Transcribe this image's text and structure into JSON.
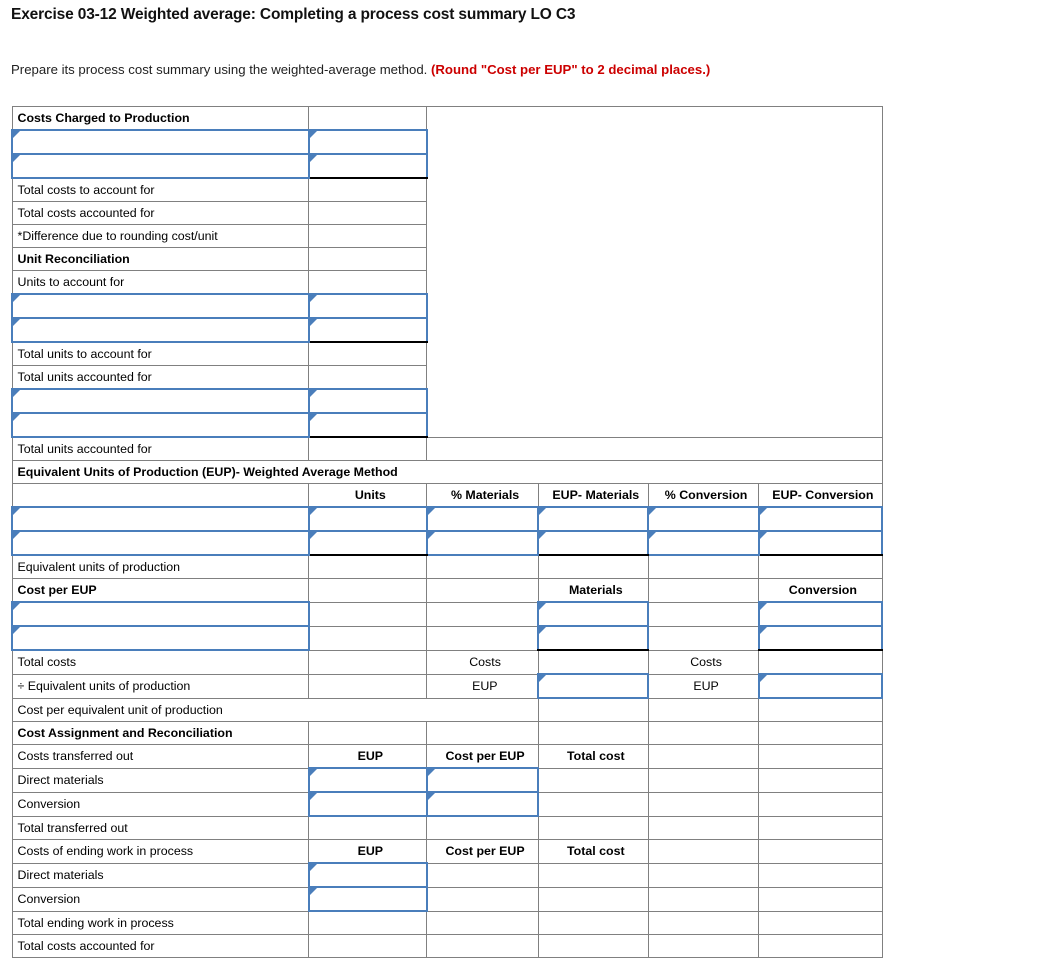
{
  "header": {
    "title": "Exercise 03-12 Weighted average: Completing a process cost summary LO C3",
    "instruction_main": "Prepare its process cost summary using the weighted-average method. ",
    "instruction_hint": "(Round \"Cost per EUP\" to 2 decimal places.)"
  },
  "colors": {
    "section_header_blue": "#7fadda",
    "input_border_blue": "#4a7ebb",
    "answer_yellow": "#fffcb3",
    "grid_gray": "#808080",
    "hint_red": "#cc0000"
  },
  "sections": {
    "costs_charged": "Costs Charged to Production",
    "unit_reconciliation": "Unit Reconciliation",
    "eup": "Equivalent Units of Production (EUP)- Weighted Average Method",
    "cost_per_eup": "Cost per EUP",
    "cost_assignment": "Cost Assignment and Reconciliation"
  },
  "column_headers": {
    "units": "Units",
    "pct_materials": "% Materials",
    "eup_materials": "EUP- Materials",
    "pct_conversion": "% Conversion",
    "eup_conversion": "EUP- Conversion"
  },
  "subheaders": {
    "materials": "Materials",
    "conversion": "Conversion",
    "eup": "EUP",
    "cost_per_eup": "Cost per EUP",
    "total_cost": "Total cost",
    "costs": "Costs"
  },
  "rows": {
    "total_costs_to_account_for": "Total costs to account for",
    "total_costs_accounted_for": "Total costs accounted for",
    "difference_rounding": "*Difference due to rounding cost/unit",
    "units_to_account_for": "Units to account for",
    "total_units_to_account_for": "Total units to account for",
    "total_units_accounted_for": "Total units accounted for",
    "equivalent_units_of_production": "Equivalent units of production",
    "total_costs": "Total costs",
    "div_equivalent_units": "÷ Equivalent units of production",
    "cost_per_equivalent_unit": "Cost per equivalent unit of production",
    "costs_transferred_out": "Costs transferred out",
    "direct_materials": "Direct materials",
    "conversion": "Conversion",
    "total_transferred_out": "Total transferred out",
    "costs_ending_wip": "Costs of ending work in process",
    "total_ending_wip": "Total ending work in process",
    "total_costs_accounted_for_final": "Total costs accounted for"
  },
  "input_cells": {
    "value": ""
  }
}
